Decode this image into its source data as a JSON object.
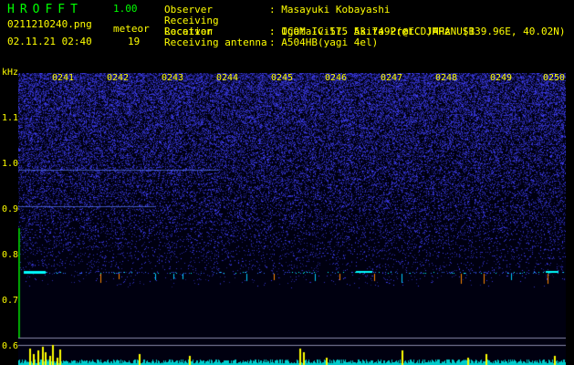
{
  "header": {
    "app_name": "HROFFT",
    "version": "1.00",
    "filename": "0211210240.png",
    "meteor_label": "meteor",
    "datetime": "02.11.21 02:40",
    "meteor_count": "19"
  },
  "info": [
    {
      "key": "Observer",
      "value": ": Masayuki Kobayashi"
    },
    {
      "key": "Receiving Location",
      "value": ": Ogata-vill. Akita-Pref. JAPAN (139.96E, 40.02N)"
    },
    {
      "key": "Receiver",
      "value": ": ICOM IC-575 53.7492(@LCD)MHz USB"
    },
    {
      "key": "Receiving antenna",
      "value": ": A504HB(yagi 4el)"
    }
  ],
  "axis": {
    "unit": "kHz",
    "y_ticks": [
      "1.1",
      "1.0",
      "0.9",
      "0.8",
      "0.7",
      "0.6"
    ],
    "time_ticks": [
      "0241",
      "0242",
      "0243",
      "0244",
      "0245",
      "0246",
      "0247",
      "0248",
      "0249",
      "0250"
    ]
  },
  "colors": {
    "background": "#000000",
    "header_text": "#ffff00",
    "app_title": "#00ff00",
    "noise": "#2a2aa8",
    "signal": "#00ffff",
    "meteor_bar": "#ffff00"
  }
}
